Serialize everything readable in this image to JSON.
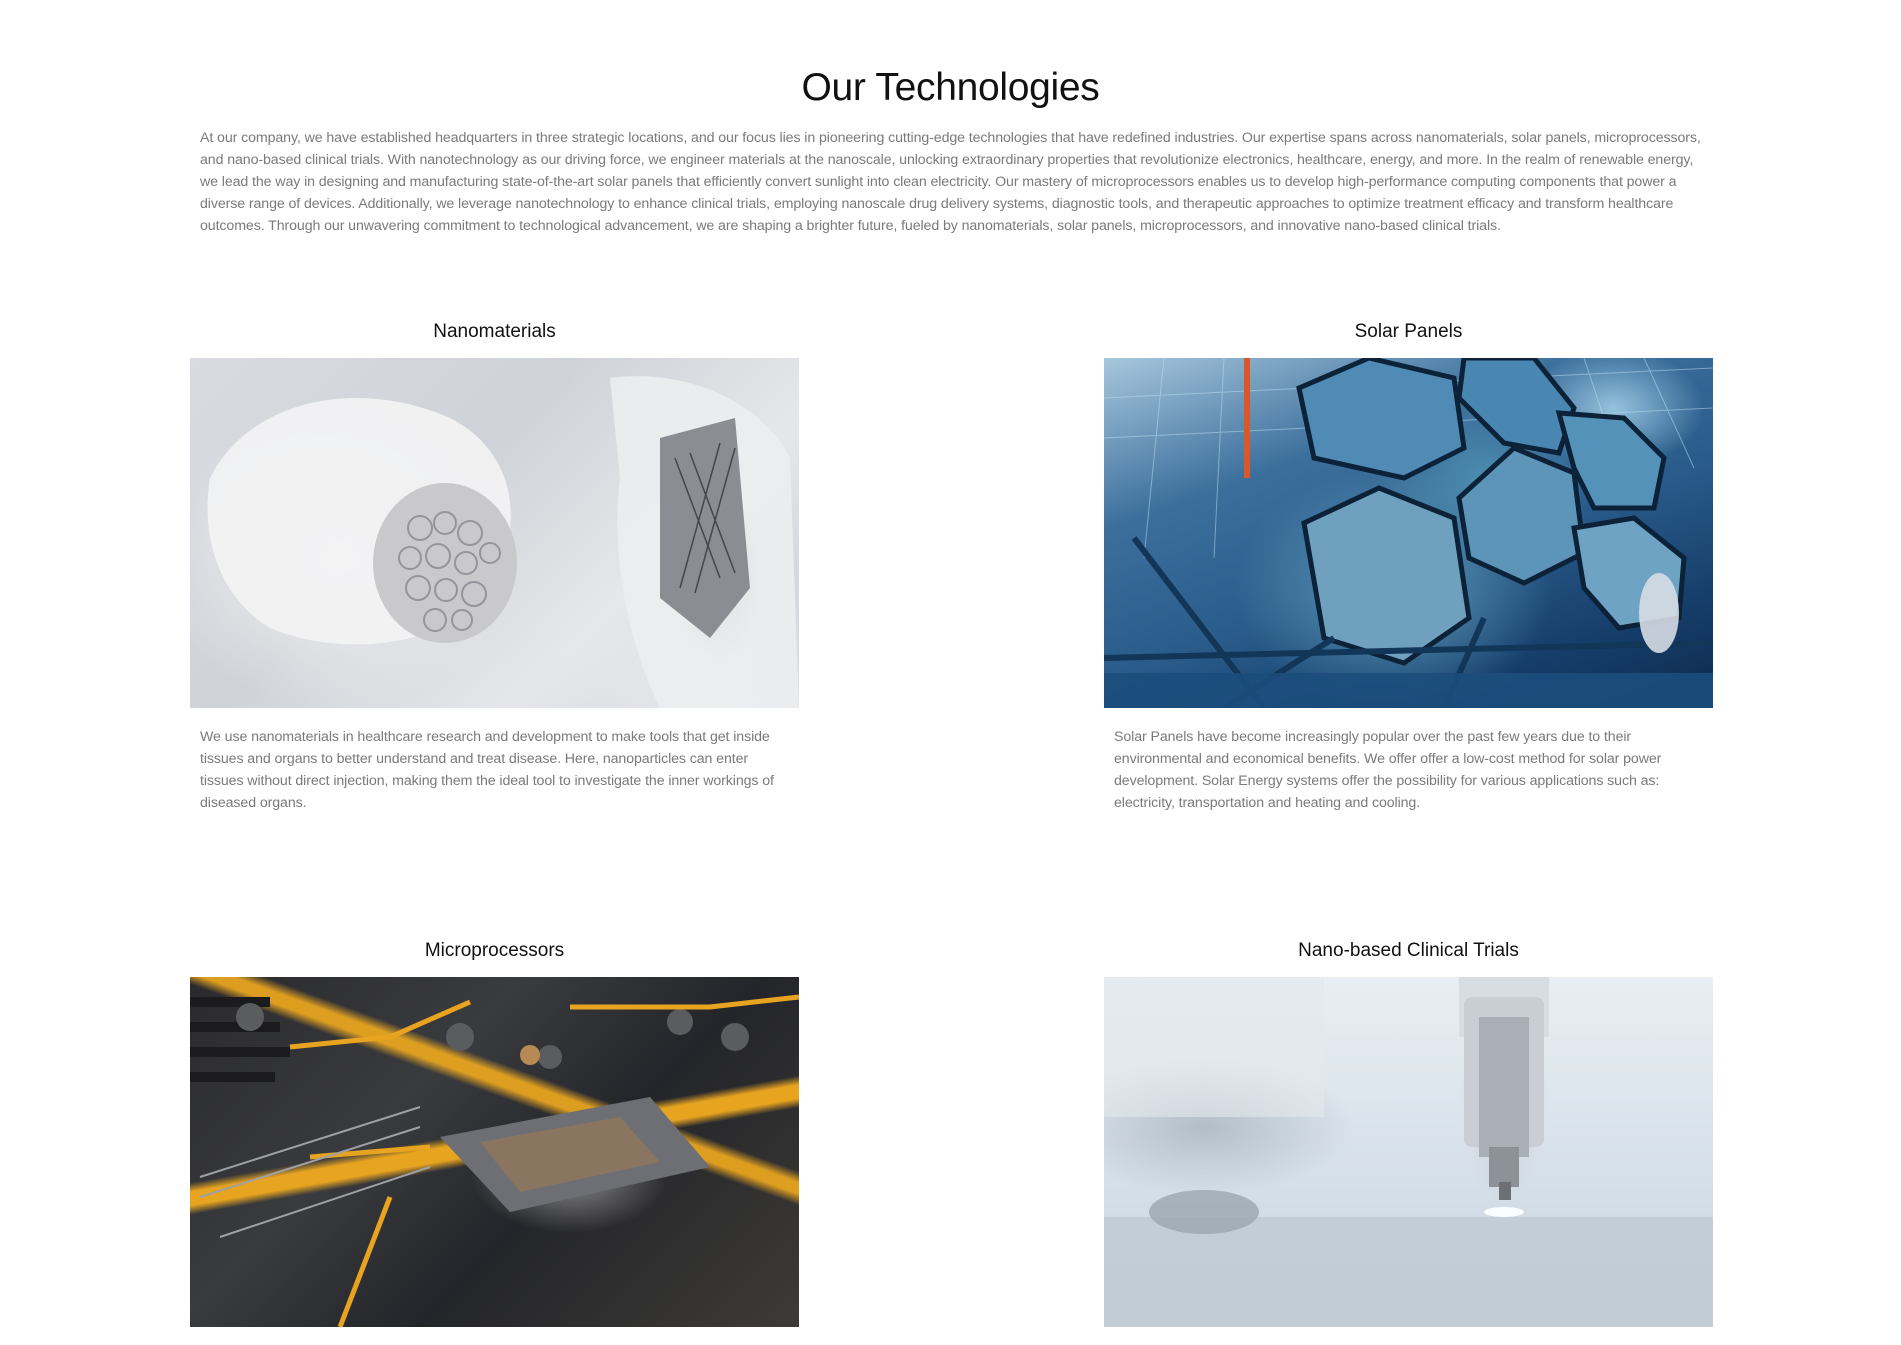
{
  "page": {
    "title": "Our Technologies",
    "intro": "At our company, we have established headquarters in three strategic locations, and our focus lies in pioneering cutting-edge technologies that have redefined industries. Our expertise spans across nanomaterials, solar panels, microprocessors, and nano-based clinical trials. With nanotechnology as our driving force, we engineer materials at the nanoscale, unlocking extraordinary properties that revolutionize electronics, healthcare, energy, and more. In the realm of renewable energy, we lead the way in designing and manufacturing state-of-the-art solar panels that efficiently convert sunlight into clean electricity. Our mastery of microprocessors enables us to develop high-performance computing components that power a diverse range of devices. Additionally, we leverage nanotechnology to enhance clinical trials, employing nanoscale drug delivery systems, diagnostic tools, and therapeutic approaches to optimize treatment efficacy and transform healthcare outcomes. Through our unwavering commitment to technological advancement, we are shaping a brighter future, fueled by nanomaterials, solar panels, microprocessors, and innovative nano-based clinical trials."
  },
  "technologies": [
    {
      "title": "Nanomaterials",
      "description": "We use nanomaterials in healthcare research and development to make tools that get inside tissues and organs to better understand and treat disease. Here, nanoparticles can enter tissues without direct injection, making them the ideal tool to investigate the inner workings of diseased organs."
    },
    {
      "title": "Solar Panels",
      "description": "Solar Panels have become increasingly popular over the past few years due to their environmental and economical benefits. We offer offer a low-cost method for solar power development. Solar Energy systems offer the possibility for various applications such as: electricity, transportation and heating and cooling."
    },
    {
      "title": "Microprocessors",
      "description": ""
    },
    {
      "title": "Nano-based Clinical Trials",
      "description": ""
    }
  ]
}
